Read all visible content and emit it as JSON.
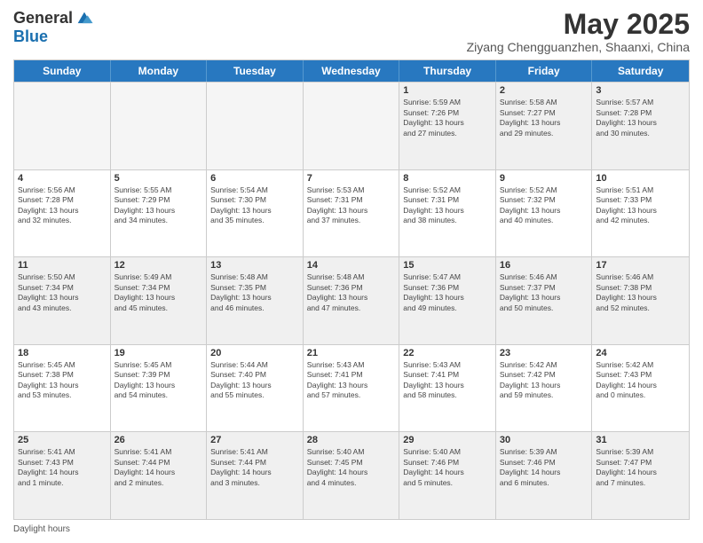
{
  "header": {
    "logo_line1": "General",
    "logo_line2": "Blue",
    "month_title": "May 2025",
    "location": "Ziyang Chengguanzhen, Shaanxi, China"
  },
  "days_of_week": [
    "Sunday",
    "Monday",
    "Tuesday",
    "Wednesday",
    "Thursday",
    "Friday",
    "Saturday"
  ],
  "weeks": [
    [
      {
        "day": "",
        "info": "",
        "empty": true
      },
      {
        "day": "",
        "info": "",
        "empty": true
      },
      {
        "day": "",
        "info": "",
        "empty": true
      },
      {
        "day": "",
        "info": "",
        "empty": true
      },
      {
        "day": "1",
        "info": "Sunrise: 5:59 AM\nSunset: 7:26 PM\nDaylight: 13 hours\nand 27 minutes."
      },
      {
        "day": "2",
        "info": "Sunrise: 5:58 AM\nSunset: 7:27 PM\nDaylight: 13 hours\nand 29 minutes."
      },
      {
        "day": "3",
        "info": "Sunrise: 5:57 AM\nSunset: 7:28 PM\nDaylight: 13 hours\nand 30 minutes."
      }
    ],
    [
      {
        "day": "4",
        "info": "Sunrise: 5:56 AM\nSunset: 7:28 PM\nDaylight: 13 hours\nand 32 minutes."
      },
      {
        "day": "5",
        "info": "Sunrise: 5:55 AM\nSunset: 7:29 PM\nDaylight: 13 hours\nand 34 minutes."
      },
      {
        "day": "6",
        "info": "Sunrise: 5:54 AM\nSunset: 7:30 PM\nDaylight: 13 hours\nand 35 minutes."
      },
      {
        "day": "7",
        "info": "Sunrise: 5:53 AM\nSunset: 7:31 PM\nDaylight: 13 hours\nand 37 minutes."
      },
      {
        "day": "8",
        "info": "Sunrise: 5:52 AM\nSunset: 7:31 PM\nDaylight: 13 hours\nand 38 minutes."
      },
      {
        "day": "9",
        "info": "Sunrise: 5:52 AM\nSunset: 7:32 PM\nDaylight: 13 hours\nand 40 minutes."
      },
      {
        "day": "10",
        "info": "Sunrise: 5:51 AM\nSunset: 7:33 PM\nDaylight: 13 hours\nand 42 minutes."
      }
    ],
    [
      {
        "day": "11",
        "info": "Sunrise: 5:50 AM\nSunset: 7:34 PM\nDaylight: 13 hours\nand 43 minutes."
      },
      {
        "day": "12",
        "info": "Sunrise: 5:49 AM\nSunset: 7:34 PM\nDaylight: 13 hours\nand 45 minutes."
      },
      {
        "day": "13",
        "info": "Sunrise: 5:48 AM\nSunset: 7:35 PM\nDaylight: 13 hours\nand 46 minutes."
      },
      {
        "day": "14",
        "info": "Sunrise: 5:48 AM\nSunset: 7:36 PM\nDaylight: 13 hours\nand 47 minutes."
      },
      {
        "day": "15",
        "info": "Sunrise: 5:47 AM\nSunset: 7:36 PM\nDaylight: 13 hours\nand 49 minutes."
      },
      {
        "day": "16",
        "info": "Sunrise: 5:46 AM\nSunset: 7:37 PM\nDaylight: 13 hours\nand 50 minutes."
      },
      {
        "day": "17",
        "info": "Sunrise: 5:46 AM\nSunset: 7:38 PM\nDaylight: 13 hours\nand 52 minutes."
      }
    ],
    [
      {
        "day": "18",
        "info": "Sunrise: 5:45 AM\nSunset: 7:38 PM\nDaylight: 13 hours\nand 53 minutes."
      },
      {
        "day": "19",
        "info": "Sunrise: 5:45 AM\nSunset: 7:39 PM\nDaylight: 13 hours\nand 54 minutes."
      },
      {
        "day": "20",
        "info": "Sunrise: 5:44 AM\nSunset: 7:40 PM\nDaylight: 13 hours\nand 55 minutes."
      },
      {
        "day": "21",
        "info": "Sunrise: 5:43 AM\nSunset: 7:41 PM\nDaylight: 13 hours\nand 57 minutes."
      },
      {
        "day": "22",
        "info": "Sunrise: 5:43 AM\nSunset: 7:41 PM\nDaylight: 13 hours\nand 58 minutes."
      },
      {
        "day": "23",
        "info": "Sunrise: 5:42 AM\nSunset: 7:42 PM\nDaylight: 13 hours\nand 59 minutes."
      },
      {
        "day": "24",
        "info": "Sunrise: 5:42 AM\nSunset: 7:43 PM\nDaylight: 14 hours\nand 0 minutes."
      }
    ],
    [
      {
        "day": "25",
        "info": "Sunrise: 5:41 AM\nSunset: 7:43 PM\nDaylight: 14 hours\nand 1 minute."
      },
      {
        "day": "26",
        "info": "Sunrise: 5:41 AM\nSunset: 7:44 PM\nDaylight: 14 hours\nand 2 minutes."
      },
      {
        "day": "27",
        "info": "Sunrise: 5:41 AM\nSunset: 7:44 PM\nDaylight: 14 hours\nand 3 minutes."
      },
      {
        "day": "28",
        "info": "Sunrise: 5:40 AM\nSunset: 7:45 PM\nDaylight: 14 hours\nand 4 minutes."
      },
      {
        "day": "29",
        "info": "Sunrise: 5:40 AM\nSunset: 7:46 PM\nDaylight: 14 hours\nand 5 minutes."
      },
      {
        "day": "30",
        "info": "Sunrise: 5:39 AM\nSunset: 7:46 PM\nDaylight: 14 hours\nand 6 minutes."
      },
      {
        "day": "31",
        "info": "Sunrise: 5:39 AM\nSunset: 7:47 PM\nDaylight: 14 hours\nand 7 minutes."
      }
    ]
  ],
  "footer": {
    "label": "Daylight hours"
  }
}
